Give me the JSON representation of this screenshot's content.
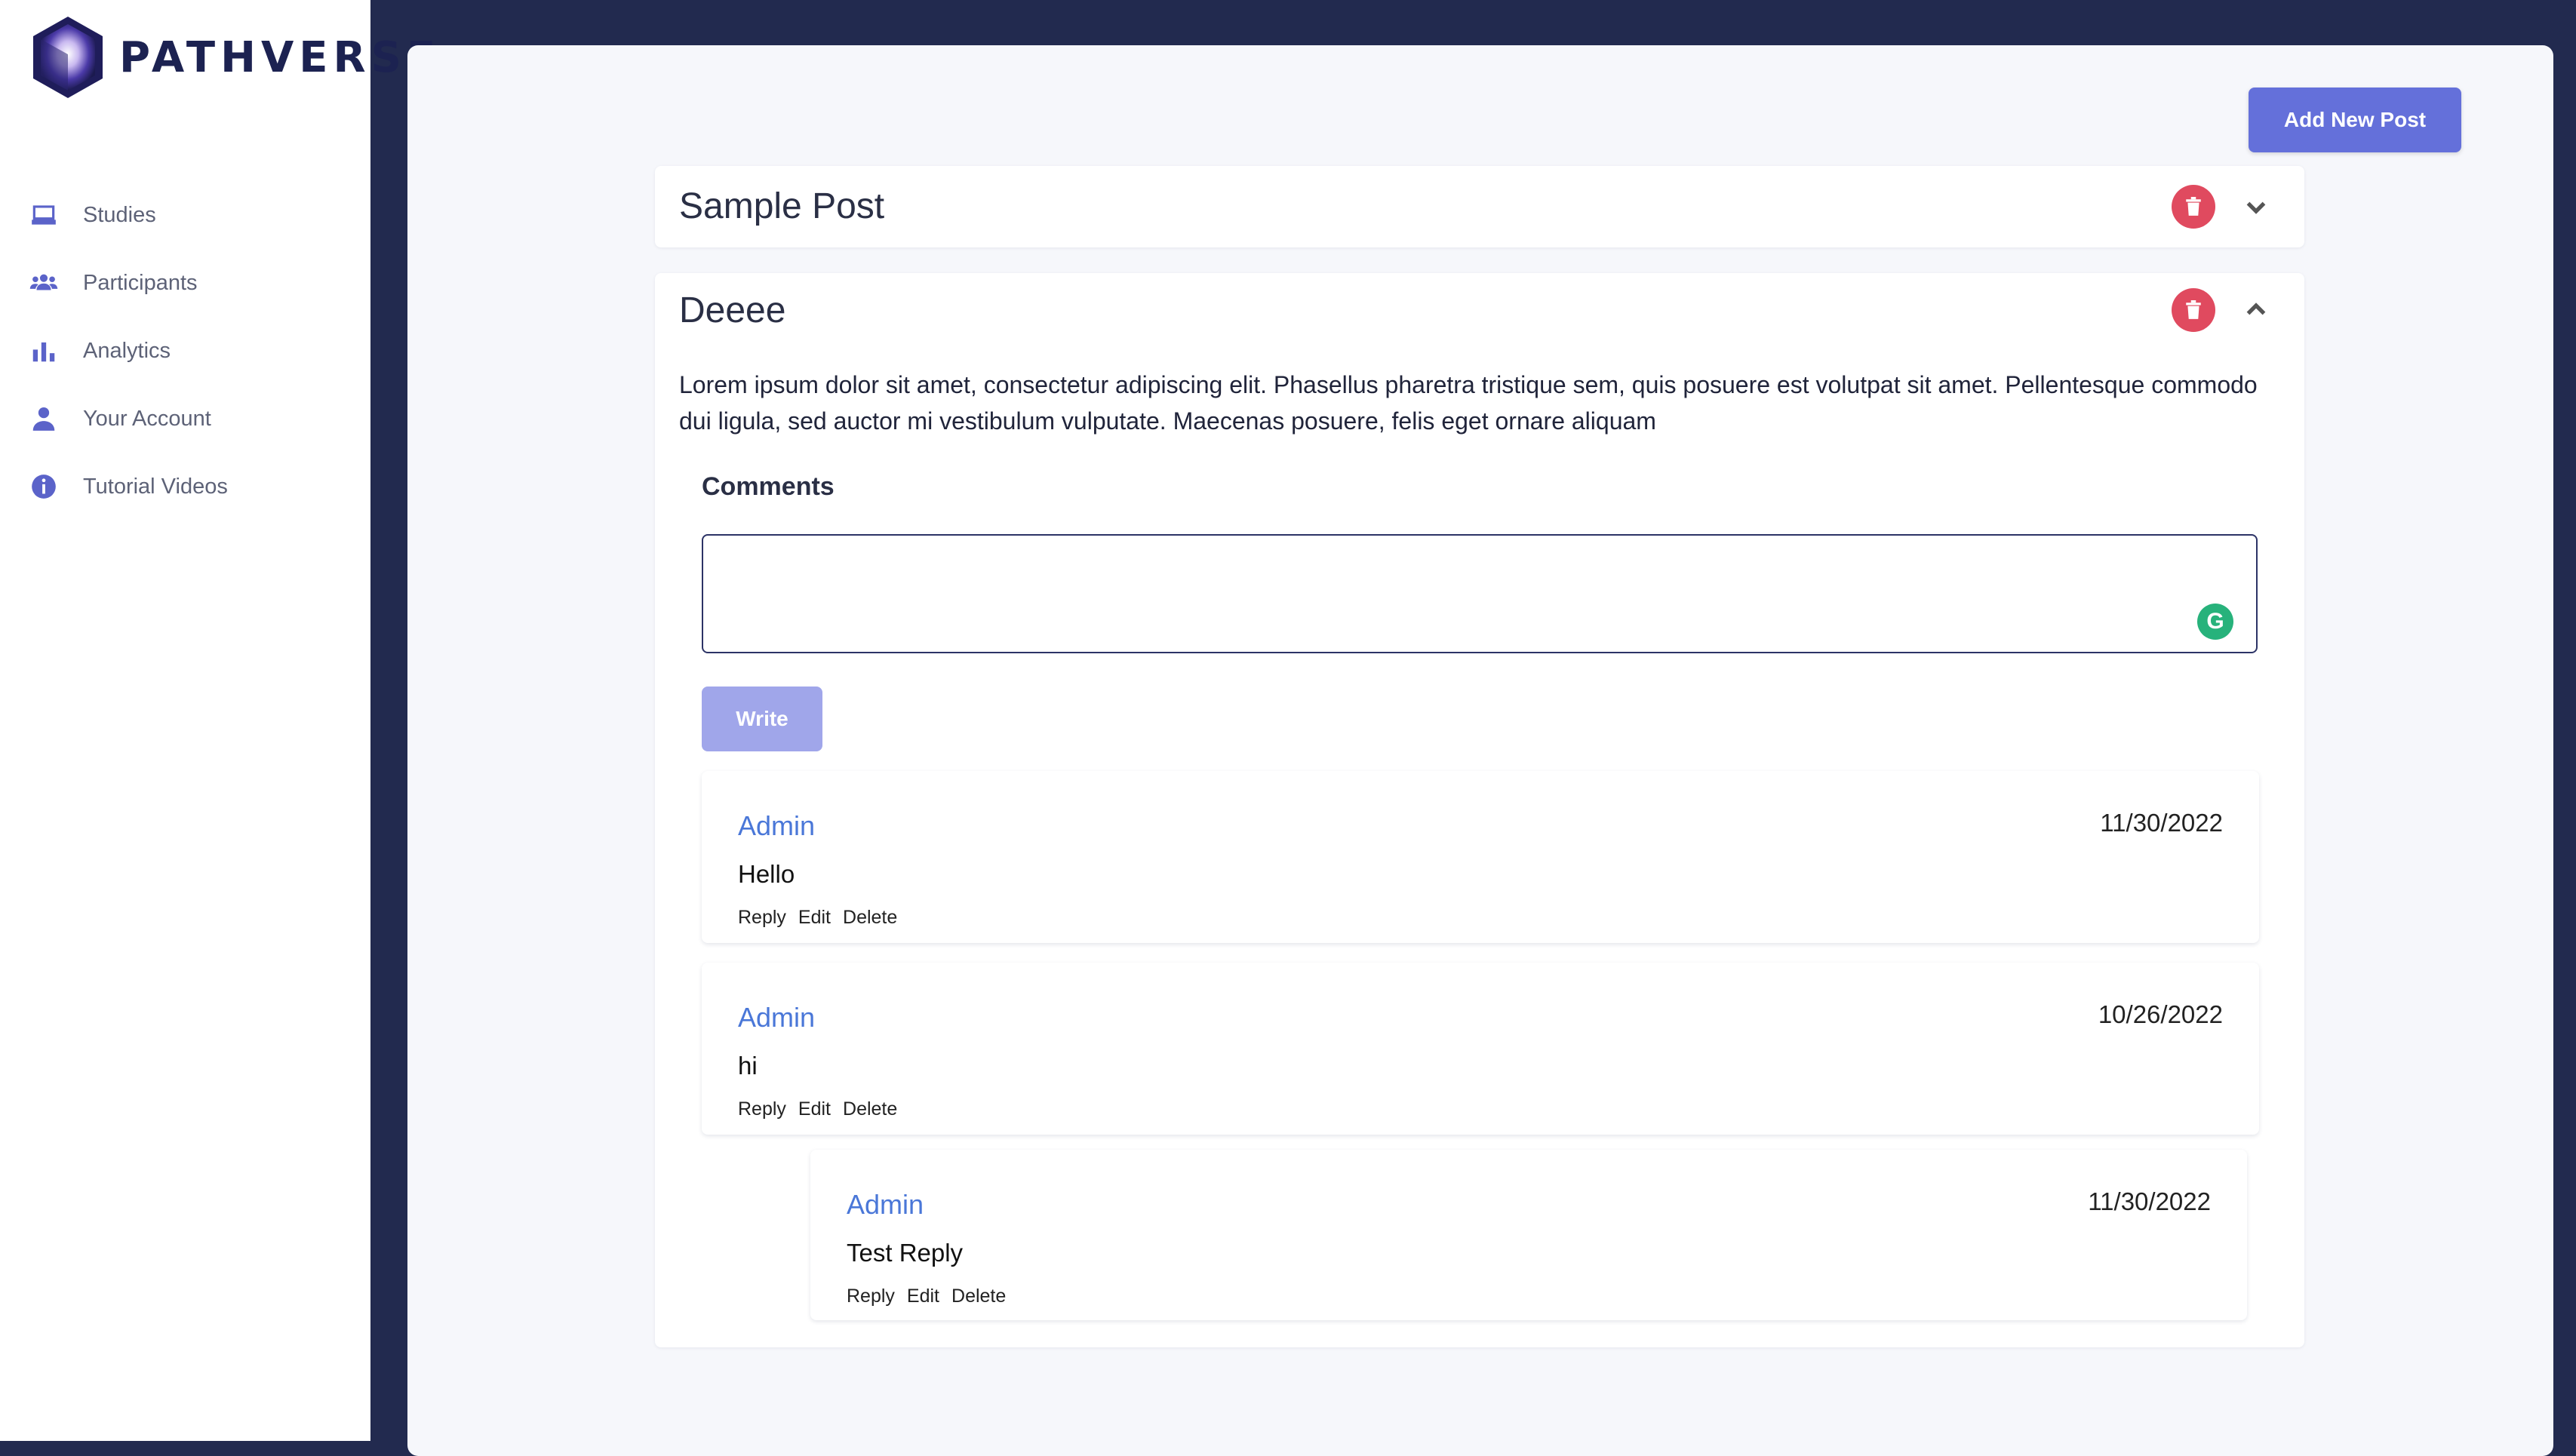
{
  "brand": {
    "name": "PATHVERSE"
  },
  "sidebar": {
    "items": [
      {
        "label": "Studies",
        "icon": "laptop-icon"
      },
      {
        "label": "Participants",
        "icon": "users-icon"
      },
      {
        "label": "Analytics",
        "icon": "bar-chart-icon"
      },
      {
        "label": "Your Account",
        "icon": "user-icon"
      },
      {
        "label": "Tutorial Videos",
        "icon": "info-icon"
      }
    ]
  },
  "toolbar": {
    "add_post_label": "Add New Post"
  },
  "posts": [
    {
      "title": "Sample Post",
      "expanded": false
    },
    {
      "title": "Deeee",
      "expanded": true,
      "body": "Lorem ipsum dolor sit amet, consectetur adipiscing elit. Phasellus pharetra tristique sem, quis posuere est volutpat sit amet. Pellentesque commodo dui ligula, sed auctor mi vestibulum vulputate. Maecenas posuere, felis eget ornare aliquam",
      "comments_label": "Comments",
      "comment_input": {
        "value": "",
        "placeholder": ""
      },
      "write_label": "Write",
      "comments": [
        {
          "author": "Admin",
          "date": "11/30/2022",
          "text": "Hello",
          "reply": "Reply",
          "edit": "Edit",
          "delete": "Delete"
        },
        {
          "author": "Admin",
          "date": "10/26/2022",
          "text": "hi",
          "reply": "Reply",
          "edit": "Edit",
          "delete": "Delete"
        },
        {
          "author": "Admin",
          "date": "11/30/2022",
          "text": "Test Reply",
          "reply": "Reply",
          "edit": "Edit",
          "delete": "Delete",
          "is_reply": true
        }
      ]
    }
  ],
  "colors": {
    "background": "#222a4f",
    "accent": "#6470da",
    "danger": "#e04a5f",
    "author_link": "#4a77d8",
    "grammarly": "#27b27b"
  }
}
